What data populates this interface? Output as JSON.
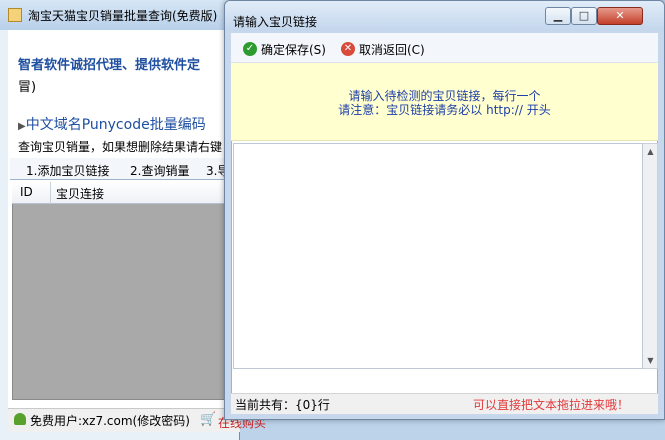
{
  "main_window": {
    "title": "淘宝天猫宝贝销量批量查询(免费版)",
    "promo_line1": "智者软件诚招代理、提供软件定",
    "promo_line2": "冒)",
    "punycode": "中文域名Punycode批量编码",
    "hint": "查询宝贝销量，如果想删除结果请右键",
    "tabs": [
      "1.添加宝贝链接",
      "2.查询销量",
      "3.导"
    ],
    "grid_columns": [
      "ID",
      "宝贝连接"
    ],
    "status_user": "免费用户:xz7.com(修改密码)",
    "status_buy": "在线购买"
  },
  "dialog": {
    "title": "请输入宝贝链接",
    "confirm_label": "确定保存(S)",
    "cancel_label": "取消返回(C)",
    "notice_line1": "请输入待检测的宝贝链接，每行一个",
    "notice_line2": "请注意：宝贝链接请务必以 http:// 开头",
    "textarea_value": "",
    "count_text": "当前共有：{0}行",
    "drag_hint": "可以直接把文本拖拉进来哦！"
  }
}
